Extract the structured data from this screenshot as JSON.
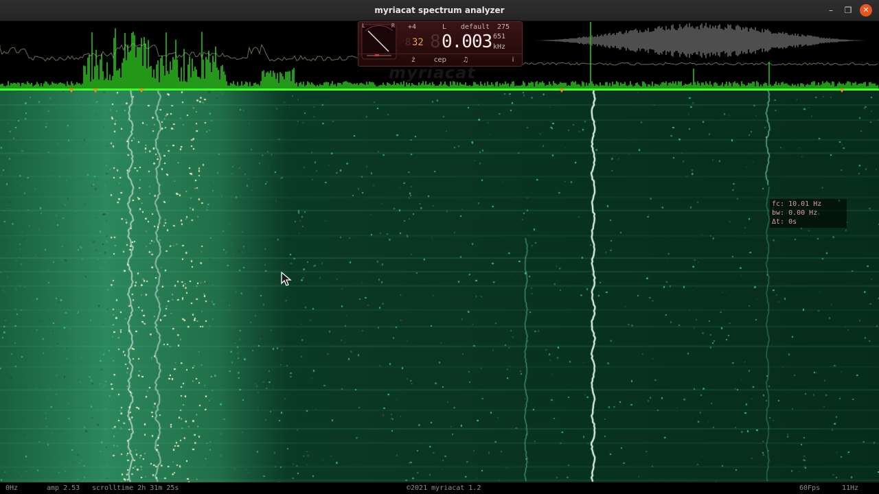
{
  "window": {
    "title": "myriacat spectrum analyzer",
    "buttons": {
      "minimize": "–",
      "maximize": "❐",
      "close": "✕"
    }
  },
  "meter": {
    "gauge_l": "L",
    "gauge_r": "R",
    "offset": "+4",
    "channel": "L",
    "preset": "default",
    "preset_value": "275",
    "small_number": "32",
    "frequency": "0.003",
    "frequency_sub": "651",
    "unit": "kHz",
    "buttons": [
      "ż",
      "cep",
      "♫",
      "i"
    ]
  },
  "watermark": "myriacat",
  "tooltip": {
    "fc": "fc: 10.01 Hz",
    "bw": "bw: 0.00 Hz",
    "dt": "Δt: 0s"
  },
  "statusbar": {
    "left_freq": "0Hz",
    "amp": "amp 2.53",
    "scrolltime": "scrolltime 2h 31m 25s",
    "copyright": "©2021 myriacat 1.2",
    "fps": "60Fps",
    "right_freq": "11Hz"
  },
  "colors": {
    "spectrum_green": "#3cff2a",
    "waterfall_base": "#0a2a1c",
    "waterfall_line": "#7dffc8",
    "marker": "#d99a22",
    "close_button": "#e95420"
  }
}
